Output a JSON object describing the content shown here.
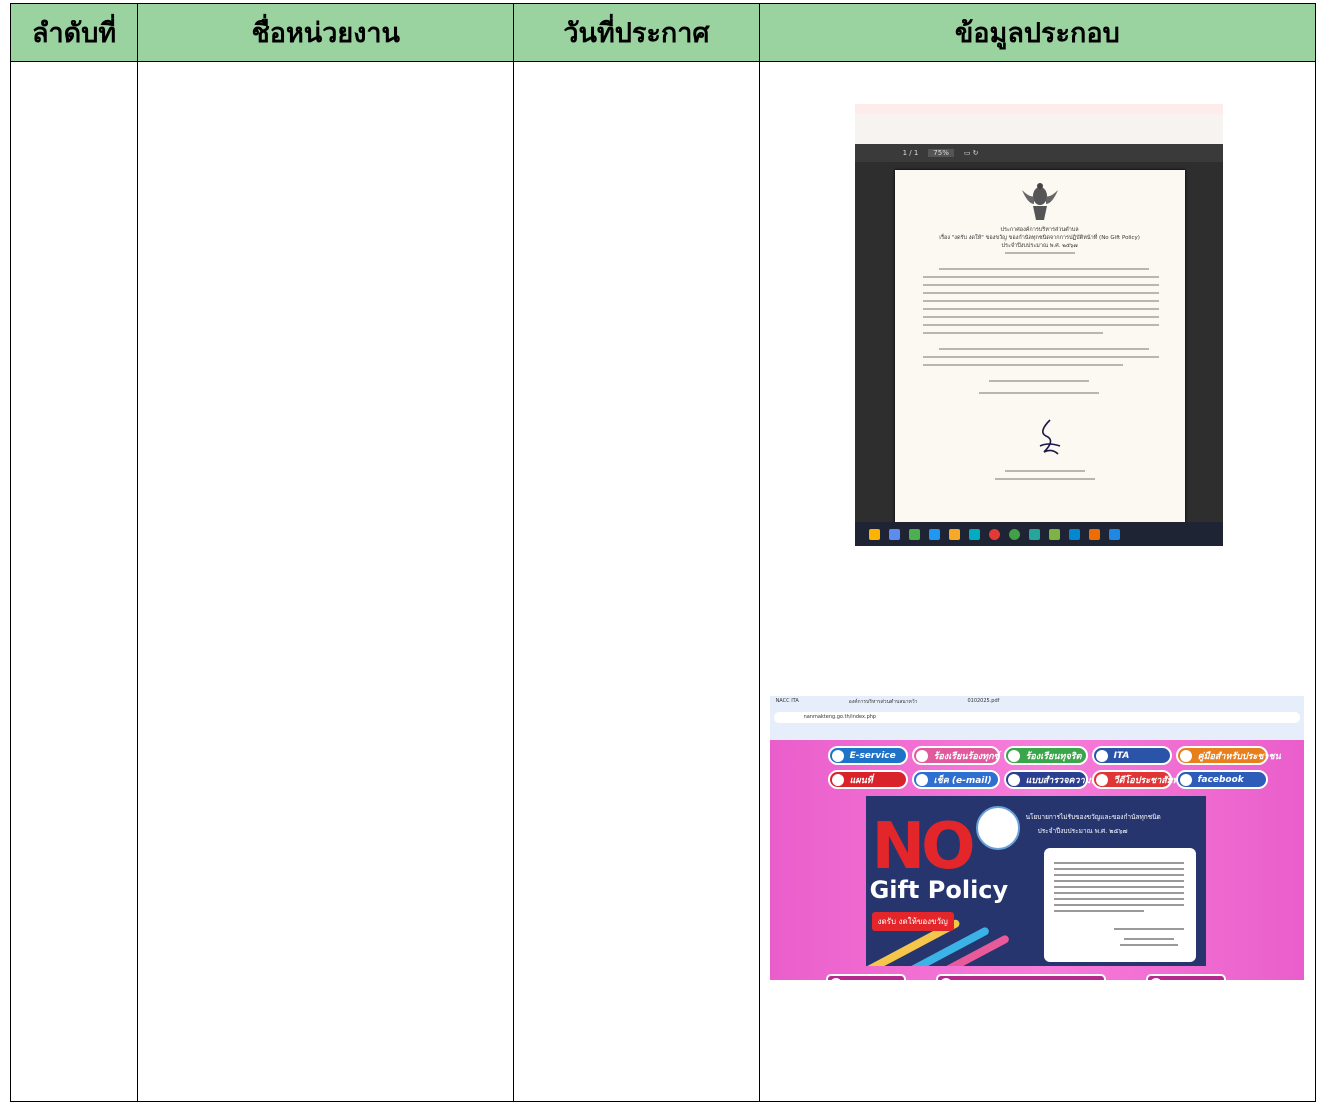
{
  "table": {
    "headers": [
      "ลำดับที่",
      "ชื่อหน่วยงาน",
      "วันที่ประกาศ",
      "ข้อมูลประกอบ"
    ]
  },
  "colors": {
    "header_bg": "#9bd3a0",
    "border": "#000000",
    "site_pink": "#ec63cf",
    "banner_navy": "#26356e"
  },
  "images": [
    {
      "kind": "scanned-announcement",
      "viewer": {
        "page": "1 / 1",
        "zoom": "75%"
      },
      "document": {
        "heading": "ประกาศองค์การบริหารส่วนตำบล",
        "subject": "เรื่อง \"งดรับ งดให้\" ของขวัญ ของกำนัลทุกชนิดจากการปฏิบัติหน้าที่ (No Gift Policy)",
        "fiscal_year": "ประจำปีงบประมาณ พ.ศ. ๒๕๖๗"
      },
      "icons": [
        "garuda-emblem-icon",
        "signature-icon"
      ]
    },
    {
      "kind": "website-screenshot",
      "browser": {
        "url": "nanmakteng.go.th/index.php",
        "tab_1": "NACC ITA",
        "tab_2": "องค์การบริหารส่วนตำบลนาหว้า",
        "tab_3": "0102025.pdf"
      },
      "nav_row_1": [
        "E-service",
        "ร้องเรียนร้องทุกข์",
        "ร้องเรียนทุจริต",
        "ITA",
        "คู่มือสำหรับประชาชน"
      ],
      "nav_row_2": [
        "แผนที่",
        "เช็ค (e-mail)",
        "แบบสำรวจความพึงพอใจ",
        "วีดีโอประชาสัมพันธ์",
        "facebook"
      ],
      "banner": {
        "big": "NO",
        "title": "Gift Policy",
        "tagline": "งดรับ งดให้ของขวัญ",
        "heading": "นโยบายการไม่รับของขวัญและของกำนัลทุกชนิด",
        "year": "ประจำปีงบประมาณ พ.ศ. ๒๕๖๗"
      }
    }
  ]
}
